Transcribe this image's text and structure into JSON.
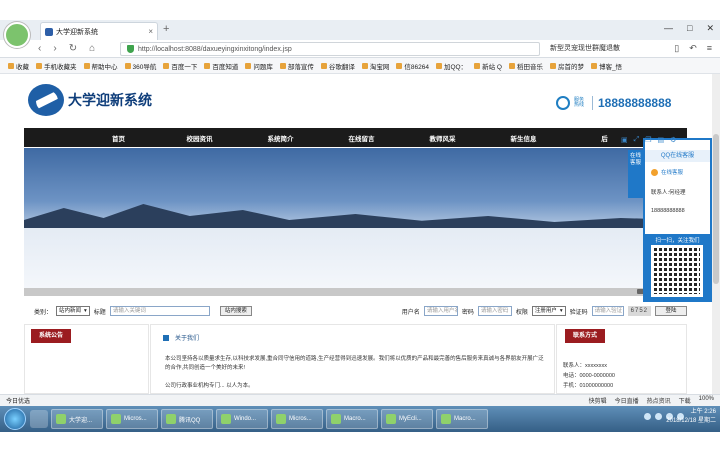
{
  "browser": {
    "tab_title": "大学迎新系统",
    "url": "http://localhost:8088/daxueyingxinxitong/index.jsp",
    "search_hint": "新型灵宠现世群魔退散",
    "bookmarks": [
      "收藏",
      "手机收藏夹",
      "帮助中心",
      "360导航",
      "百度一下",
      "百度知道",
      "问题库",
      "部落宣传",
      "谷歌翻译",
      "淘宝网",
      "信86264",
      "加QQ：",
      "新站 Q",
      "稻田音乐",
      "房首的梦",
      "博客_悟"
    ]
  },
  "site": {
    "title": "大学迎新系统",
    "hotline_label": "服务热线",
    "hotline": "18888888888",
    "nav": [
      "首页",
      "校园资讯",
      "系统简介",
      "在线留言",
      "教师风采",
      "新生信息",
      "后"
    ]
  },
  "search": {
    "type_label": "类别：",
    "type_value": "站内新闻",
    "title_label": "标题",
    "title_placeholder": "请输入关键词",
    "search_btn": "站内搜索",
    "user_label": "用户名",
    "user_placeholder": "请输入用户名",
    "pwd_label": "密码",
    "pwd_placeholder": "请输入密码",
    "role_label": "权限",
    "role_value": "注册用户",
    "code_label": "验证码",
    "code_placeholder": "请输入验证",
    "captcha": "6752",
    "login_btn": "登陆"
  },
  "panels": {
    "notice_title": "系统公告",
    "about_title": "关于我们",
    "about_text_1": "本公司坚持各以质量求生存,以科技求发展,重合同守信用的道路,生产经营得到迅速发展。我们将以优质的产品和最完善的售后服务来真诚与各界朋友开展广泛的合作,共同创造一个美好的未来!",
    "about_text_2": "公司行政事业机构专门... 以人为本。",
    "contact_title": "联系方式",
    "contact_person": "联系人：xxxxxxxx",
    "contact_phone": "电话：0000-0000000",
    "contact_mobile": "手机：01000000000"
  },
  "qq_widget": {
    "strip": "在线客服",
    "header": "QQ在线客服",
    "service": "在线客服",
    "contact": "联系人:何经理",
    "phone": "18888888888",
    "scan": "扫一扫，关注我们"
  },
  "statusbar": {
    "left": "今日优选",
    "items": [
      "快剪辑",
      "今日直播",
      "热点资讯",
      "下载",
      "100%"
    ]
  },
  "taskbar": {
    "items": [
      "大学迎...",
      "Micros...",
      "腾讯QQ",
      "Windo...",
      "Micros...",
      "Macro...",
      "MyEcli...",
      "Macro..."
    ],
    "time": "上午 2:26",
    "date": "2018/12/18 星期二"
  }
}
